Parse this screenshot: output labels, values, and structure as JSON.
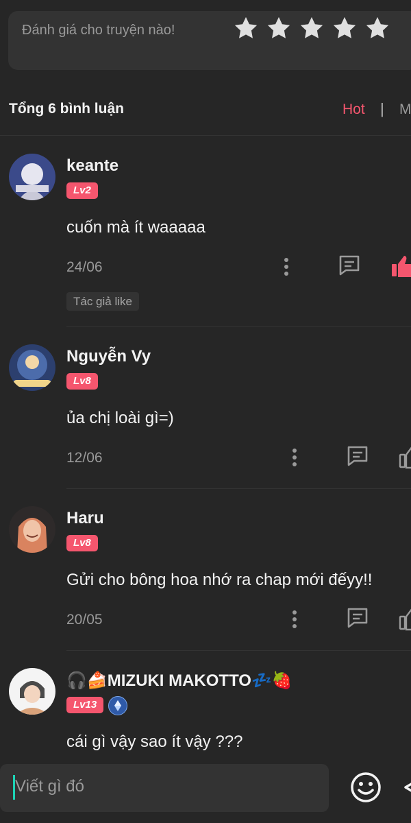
{
  "rating": {
    "prompt": "Đánh giá cho truyện nào!",
    "stars": [
      {
        "icon": "star-icon"
      },
      {
        "icon": "star-icon"
      },
      {
        "icon": "star-icon"
      },
      {
        "icon": "star-icon"
      },
      {
        "icon": "star-icon"
      }
    ]
  },
  "comments_header": {
    "title": "Tổng 6 bình luận",
    "sort_hot": "Hot",
    "separator": "|",
    "sort_new": "M"
  },
  "comments": [
    {
      "username": "keante",
      "level": "Lv2",
      "text": "cuốn mà ít waaaaa",
      "date": "24/06",
      "liked": true,
      "author_like": "Tác giả like"
    },
    {
      "username": "Nguyễn Vy",
      "level": "Lv8",
      "text": "ủa chị loài gì=)",
      "date": "12/06",
      "liked": false
    },
    {
      "username": "Haru",
      "level": "Lv8",
      "text": "Gửi cho bông hoa nhớ ra chap mới đếyy!!",
      "date": "20/05",
      "liked": false
    },
    {
      "username": "🎧🍰MIZUKI MAKOTTO💤🍓",
      "level": "Lv13",
      "text": "cái gì vậy sao ít vậy ???",
      "badge_icon": "crystal-badge-icon"
    }
  ],
  "input": {
    "placeholder": "Viết gì đó"
  },
  "colors": {
    "background": "#262626",
    "accent": "#f5566e",
    "muted_text": "#9a9a9a",
    "cursor": "#1dd3b5"
  }
}
